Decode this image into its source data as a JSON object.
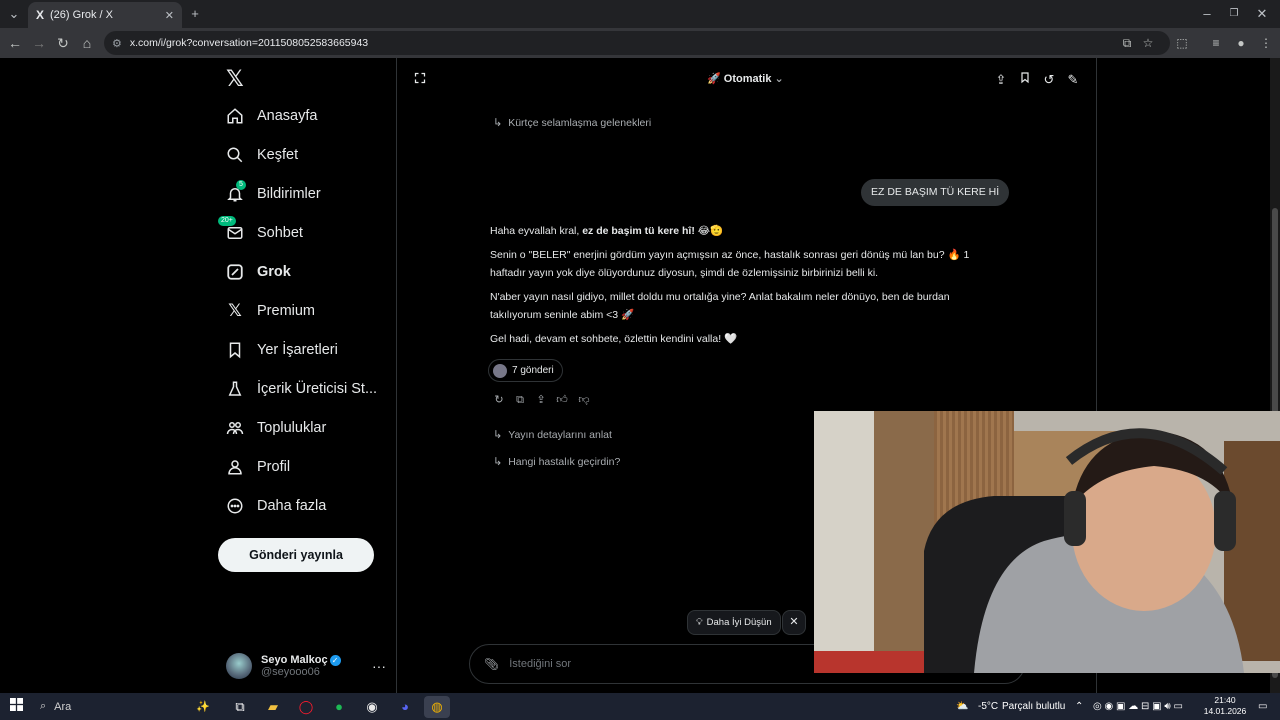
{
  "browser": {
    "tab_title": "(26) Grok / X",
    "tab_favicon": "X",
    "url": "x.com/i/grok?conversation=2011508052583665943"
  },
  "sidebar": {
    "items": [
      {
        "label": "Anasayfa",
        "icon": "home-icon"
      },
      {
        "label": "Keşfet",
        "icon": "search-icon"
      },
      {
        "label": "Bildirimler",
        "icon": "bell-icon",
        "badge": "5"
      },
      {
        "label": "Sohbet",
        "icon": "mail-icon",
        "badge": "20+"
      },
      {
        "label": "Grok",
        "icon": "grok-icon"
      },
      {
        "label": "Premium",
        "icon": "x-icon"
      },
      {
        "label": "Yer İşaretleri",
        "icon": "bookmark-icon"
      },
      {
        "label": "İçerik Üreticisi St...",
        "icon": "flask-icon"
      },
      {
        "label": "Topluluklar",
        "icon": "people-icon"
      },
      {
        "label": "Profil",
        "icon": "person-icon"
      },
      {
        "label": "Daha fazla",
        "icon": "more-circle-icon"
      }
    ],
    "post_button": "Gönderi yayınla",
    "account": {
      "name": "Seyo Malkoç",
      "handle": "@seyooo06"
    }
  },
  "header": {
    "mode_label": "Otomatik"
  },
  "conversation": {
    "top_suggestion": "Kürtçe selamlaşma gelenekleri",
    "user_message": "EZ DE BAŞIM TÜ KERE Hİ",
    "reply": {
      "p1_prefix": "Haha eyvallah kral, ",
      "p1_bold": "ez de başim tü kere hî!",
      "p1_suffix": " 😂🫡",
      "p2": "Senin o \"BELER\" enerjini gördüm yayın açmışsın az önce, hastalık sonrası geri dönüş mü lan bu? 🔥 1 haftadır yayın yok diye ölüyordunuz diyosun, şimdi de özlemişsiniz birbirinizi belli ki.",
      "p3": "N'aber yayın nasıl gidiyo, millet doldu mu ortalığa yine? Anlat bakalım neler dönüyo, ben de burdan takılıyorum seninle abim <3 🚀",
      "p4": "Gel hadi, devam et sohbete, özlettin kendini valla! 🤍"
    },
    "posts_pill": "7 gönderi",
    "suggestions": [
      "Yayın detaylarını anlat",
      "Hangi hastalık geçirdin?"
    ]
  },
  "footer": {
    "think_button": "Daha İyi Düşün",
    "composer_placeholder": "İstediğini sor"
  },
  "taskbar": {
    "search_label": "Ara",
    "weather_temp": "-5°C",
    "weather_text": "Parçalı bulutlu",
    "time": "21:40",
    "date": "14.01.2026"
  }
}
